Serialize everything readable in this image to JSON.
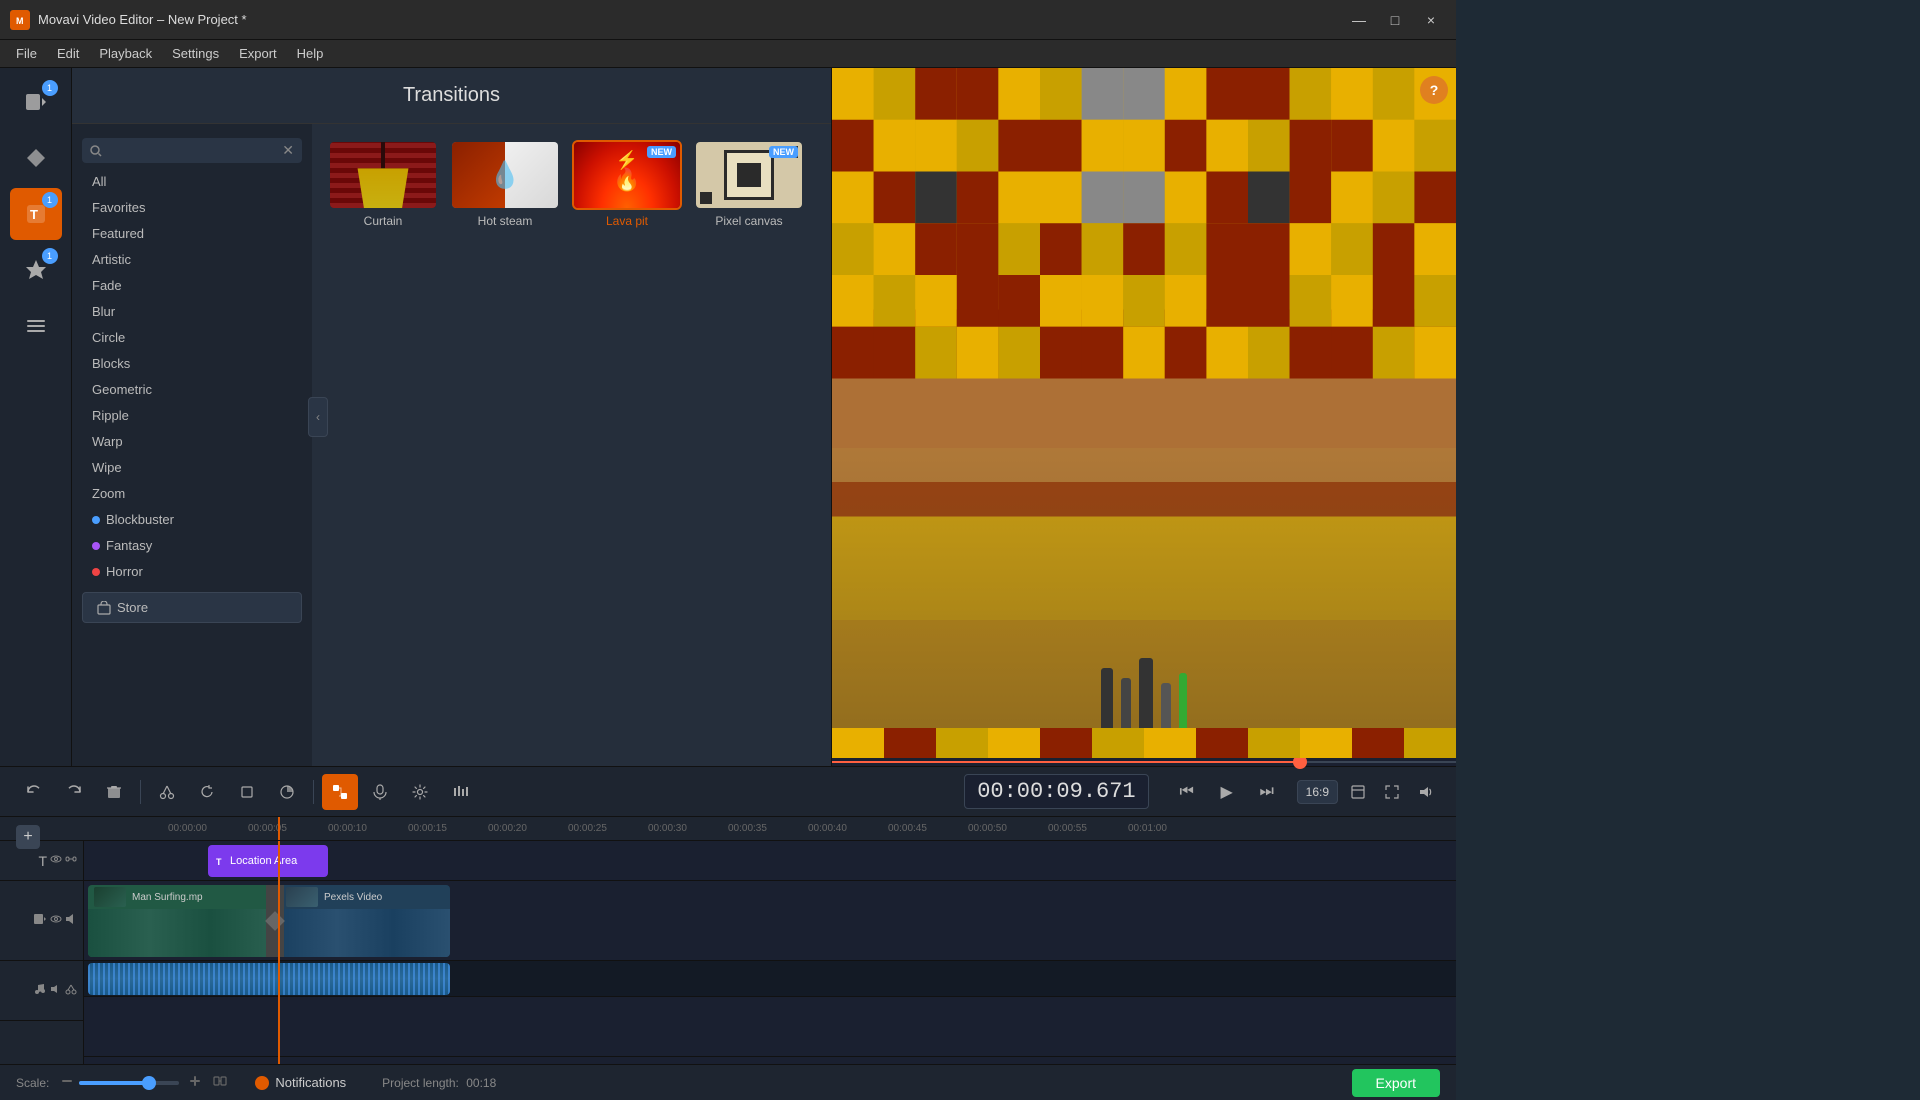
{
  "window": {
    "title": "Movavi Video Editor – New Project *",
    "app_icon": "M"
  },
  "menubar": {
    "items": [
      "File",
      "Edit",
      "Playback",
      "Settings",
      "Export",
      "Help"
    ]
  },
  "sidebar": {
    "buttons": [
      {
        "id": "video",
        "icon": "▶",
        "label": "Video",
        "badge": "1",
        "active": false
      },
      {
        "id": "transitions",
        "icon": "✦",
        "label": "Transitions",
        "badge": null,
        "active": false
      },
      {
        "id": "titles",
        "icon": "T",
        "label": "Titles",
        "badge": "1",
        "active": true
      },
      {
        "id": "effects",
        "icon": "★",
        "label": "Effects",
        "badge": "1",
        "active": false
      },
      {
        "id": "filters",
        "icon": "≡",
        "label": "Filters",
        "badge": null,
        "active": false
      }
    ]
  },
  "transitions": {
    "title": "Transitions",
    "search_placeholder": "",
    "categories": [
      {
        "label": "All",
        "dot": null
      },
      {
        "label": "Favorites",
        "dot": null
      },
      {
        "label": "Featured",
        "dot": null
      },
      {
        "label": "Artistic",
        "dot": null
      },
      {
        "label": "Fade",
        "dot": null
      },
      {
        "label": "Blur",
        "dot": null
      },
      {
        "label": "Circle",
        "dot": null
      },
      {
        "label": "Blocks",
        "dot": null
      },
      {
        "label": "Geometric",
        "dot": null
      },
      {
        "label": "Ripple",
        "dot": null
      },
      {
        "label": "Warp",
        "dot": null
      },
      {
        "label": "Wipe",
        "dot": null
      },
      {
        "label": "Zoom",
        "dot": null
      },
      {
        "label": "Blockbuster",
        "dot": "blue"
      },
      {
        "label": "Fantasy",
        "dot": "purple"
      },
      {
        "label": "Horror",
        "dot": "red"
      }
    ],
    "store_label": "Store",
    "items": [
      {
        "id": "curtain",
        "label": "Curtain",
        "new": false,
        "selected": false,
        "type": "curtain"
      },
      {
        "id": "hot_steam",
        "label": "Hot steam",
        "new": false,
        "selected": false,
        "type": "hotsteam"
      },
      {
        "id": "lava_pit",
        "label": "Lava pit",
        "new": true,
        "selected": true,
        "type": "lavapit"
      },
      {
        "id": "pixel_canvas",
        "label": "Pixel canvas",
        "new": true,
        "selected": false,
        "type": "pixelcanvas"
      }
    ]
  },
  "preview": {
    "help_label": "?",
    "time": "00:00:09.671",
    "progress_percent": 75,
    "aspect_ratio": "16:9"
  },
  "toolbar": {
    "undo": "↩",
    "redo": "↪",
    "delete": "🗑",
    "cut": "✂",
    "rotate": "↻",
    "crop": "⊡",
    "color": "◑",
    "transitions_icon": "⧉",
    "audio": "🎤",
    "settings": "⚙",
    "equalizer": "⋮",
    "play_prev": "⏮",
    "play": "▶",
    "play_next": "⏭",
    "volume": "🔊",
    "expand": "⤢",
    "fullscreen": "⛶"
  },
  "timeline": {
    "ruler_marks": [
      "00:00:00",
      "00:00:05",
      "00:00:10",
      "00:00:15",
      "00:00:20",
      "00:00:25",
      "00:00:30",
      "00:00:35",
      "00:00:40",
      "00:00:45",
      "00:00:50",
      "00:00:55",
      "00:01:00"
    ],
    "tracks": [
      {
        "type": "text",
        "clip_label": "Location Area"
      },
      {
        "type": "video",
        "clips": [
          {
            "label": "Man Surfing.mp",
            "start": 0
          },
          {
            "label": "Pexels Video",
            "start": 190
          }
        ]
      },
      {
        "type": "music",
        "label": "music track"
      }
    ],
    "playhead_time": "00:00:10"
  },
  "bottombar": {
    "scale_label": "Scale:",
    "notifications_label": "Notifications",
    "project_length_label": "Project length:",
    "project_length": "00:18",
    "export_label": "Export"
  },
  "window_controls": {
    "minimize": "—",
    "maximize": "□",
    "close": "×"
  }
}
